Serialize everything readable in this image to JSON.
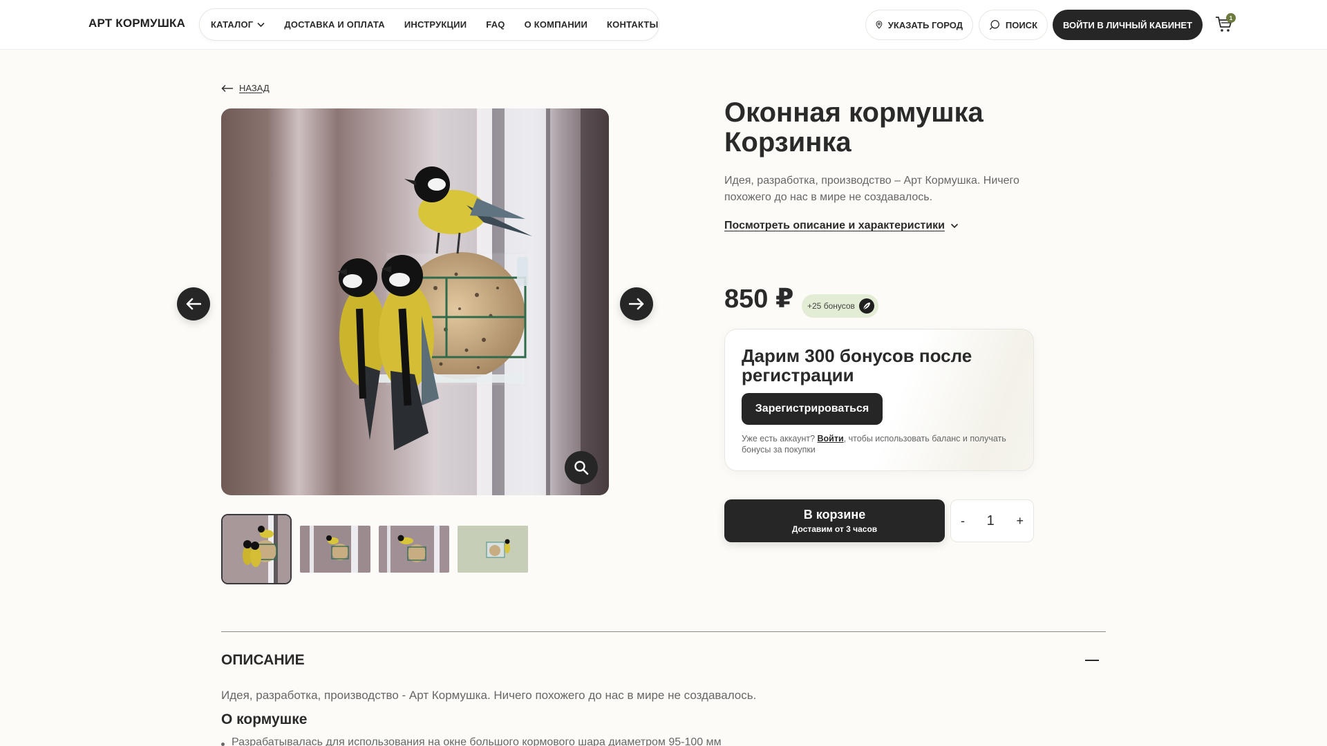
{
  "header": {
    "logo": "АРТ КОРМУШКА",
    "nav": [
      {
        "label": "КАТАЛОГ",
        "has_dropdown": true
      },
      {
        "label": "ДОСТАВКА И ОПЛАТА"
      },
      {
        "label": "ИНСТРУКЦИИ"
      },
      {
        "label": "FAQ"
      },
      {
        "label": "О КОМПАНИИ"
      },
      {
        "label": "КОНТАКТЫ"
      }
    ],
    "city_label": "УКАЗАТЬ ГОРОД",
    "search_label": "ПОИСК",
    "login_label": "ВОЙТИ В ЛИЧНЫЙ КАБИНЕТ",
    "cart_count": "1"
  },
  "back_label": "НАЗАД",
  "gallery": {
    "main_image": "two great tits and one above on window feeder with seed ball",
    "thumbnails": [
      "thumb-1",
      "thumb-2",
      "thumb-3",
      "thumb-4"
    ],
    "active_thumbnail": 0
  },
  "product": {
    "title": "Оконная кормушка Корзинка",
    "description": "Идея, разработка, производство – Арт Кормушка. Ничего похожего до нас в мире не создавалось.",
    "details_link": "Посмотреть описание и характеристики",
    "price": "850 ₽",
    "bonus": "+25 бонусов"
  },
  "promo": {
    "title": "Дарим 300 бонусов после регистрации",
    "button": "Зарегистрироваться",
    "note_before": "Уже есть аккаунт? ",
    "note_link": "Войти",
    "note_after": ", чтобы использовать баланс и получать бонусы за покупки"
  },
  "cart": {
    "button_main": "В корзине",
    "button_sub": "Доставим от 3 часов",
    "minus": "-",
    "plus": "+",
    "quantity": "1"
  },
  "description_section": {
    "title": "ОПИСАНИЕ",
    "text": "Идея, разработка, производство - Арт Кормушка. Ничего похожего до нас в мире не создавалось.",
    "subtitle": "О кормушке",
    "bullet": "Разрабатывалась для использования на окне большого кормового шара диаметром 95-100 мм"
  },
  "colors": {
    "background": "#fcfbf7",
    "dark": "#262626",
    "bonus_bg": "#e3ecd4",
    "accent": "#6b7a3e"
  },
  "icons": [
    "chevron-down-icon",
    "location-pin-icon",
    "search-icon",
    "cart-icon",
    "arrow-left-icon",
    "arrow-right-icon",
    "zoom-icon",
    "leaf-icon",
    "minus-icon"
  ]
}
